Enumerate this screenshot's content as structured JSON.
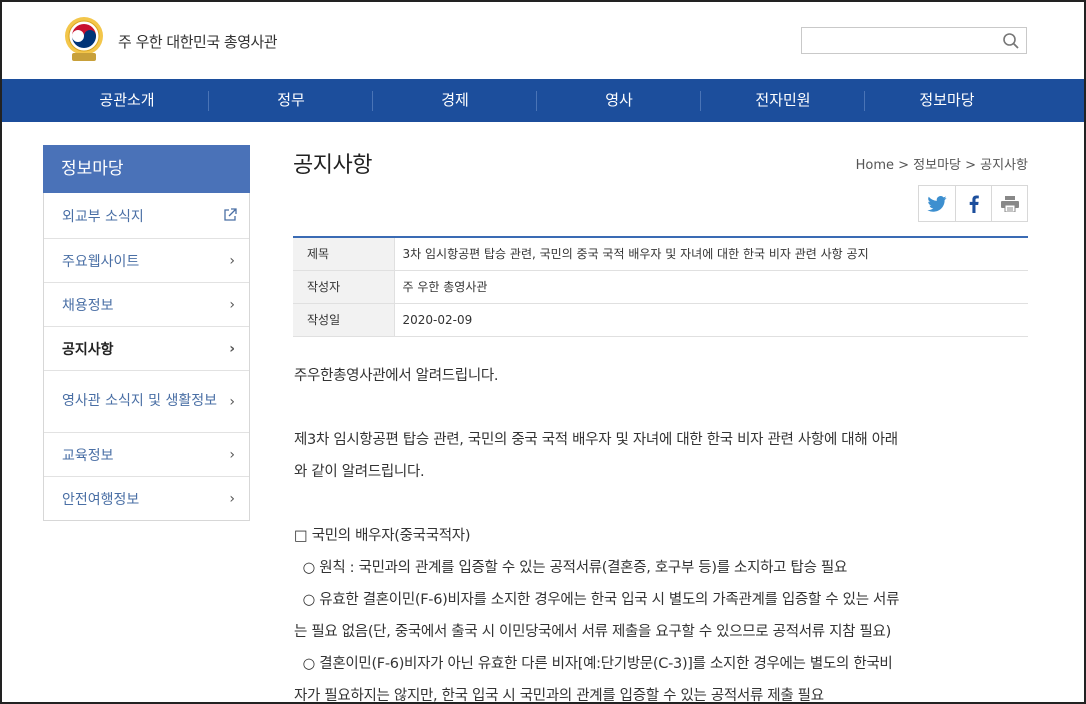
{
  "header": {
    "site_name": "주 우한 대한민국 총영사관",
    "search_placeholder": ""
  },
  "gnb": [
    "공관소개",
    "정무",
    "경제",
    "영사",
    "전자민원",
    "정보마당"
  ],
  "lnb": {
    "title": "정보마당",
    "items": [
      {
        "label": "외교부 소식지",
        "icon": "external-link-icon"
      },
      {
        "label": "주요웹사이트",
        "icon": "chevron-right-icon"
      },
      {
        "label": "채용정보",
        "icon": "chevron-right-icon"
      },
      {
        "label": "공지사항",
        "icon": "chevron-right-icon",
        "active": true
      },
      {
        "label": "영사관 소식지 및 생활정보",
        "icon": "chevron-right-icon"
      },
      {
        "label": "교육정보",
        "icon": "chevron-right-icon"
      },
      {
        "label": "안전여행정보",
        "icon": "chevron-right-icon"
      }
    ]
  },
  "content": {
    "page_title": "공지사항",
    "breadcrumb": "Home > 정보마당 > 공지사항",
    "share": [
      "twitter-icon",
      "facebook-icon",
      "print-icon"
    ],
    "info": {
      "subject_label": "제목",
      "subject": "3차 임시항공편 탑승 관련, 국민의 중국 국적 배우자 및 자녀에 대한 한국 비자 관련 사항 공지",
      "author_label": "작성자",
      "author": "주 우한 총영사관",
      "date_label": "작성일",
      "date": "2020-02-09"
    },
    "body": {
      "p1": "주우한총영사관에서 알려드립니다.",
      "p2a": "제3차 임시항공편 탑승 관련, 국민의 중국 국적 배우자 및 자녀에 대한 한국 비자 관련 사항에 대해 아래",
      "p2b": "와 같이 알려드립니다.",
      "s1": "□ 국민의 배우자(중국국적자)",
      "s1a": "  ○ 원칙 : 국민과의 관계를 입증할 수 있는 공적서류(결혼증, 호구부 등)를 소지하고 탑승 필요",
      "s1b1": "  ○ 유효한 결혼이민(F-6)비자를 소지한 경우에는 한국 입국 시 별도의 가족관계를 입증할 수 있는 서류",
      "s1b2": "는 필요 없음(단, 중국에서 출국 시 이민당국에서 서류 제출을 요구할 수 있으므로 공적서류 지참 필요)",
      "s1c1": "  ○ 결혼이민(F-6)비자가 아닌 유효한 다른 비자[예:단기방문(C-3)]를 소지한 경우에는 별도의 한국비",
      "s1c2": "자가 필요하지는 않지만, 한국 입국 시 국민과의 관계를 입증할 수 있는 공적서류 제출 필요"
    }
  },
  "colors": {
    "gnb_bg": "#1c4e9c",
    "lnb_title_bg": "#4a72b8",
    "table_top_border": "#3a6bb4",
    "lnb_link": "#4a6fa5"
  }
}
